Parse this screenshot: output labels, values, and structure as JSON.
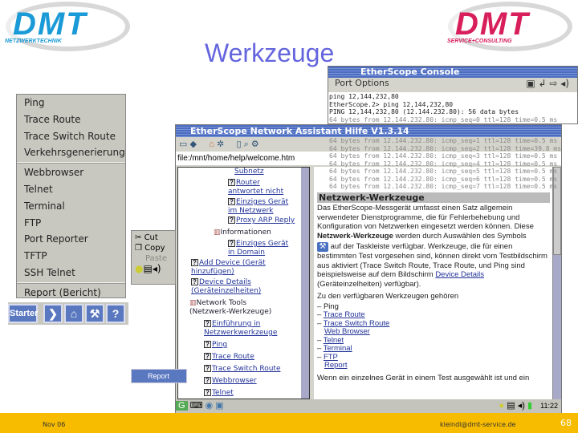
{
  "slide": {
    "title": "Werkzeuge",
    "footer_date": "Nov 06",
    "footer_email": "kleindl@dmt-service.de",
    "page_number": "68"
  },
  "logos": {
    "left": {
      "text": "DMT",
      "tagline": "NETZWERKTECHNIK",
      "color": "#1a9ad6"
    },
    "right": {
      "text": "DMT",
      "tagline": "SERVICE+CONSULTING",
      "color": "#d81e5b"
    }
  },
  "console": {
    "title": "EtherScope Console",
    "menu": "Port Options",
    "lines": [
      "ping 12,144,232,80",
      "EtherScope.2> ping 12,144,232,80",
      "PING 12,144,232,80 (12.144.232.80): 56 data bytes",
      "64 bytes from 12.144.232.80: icmp_seq=0 ttl=128 time=0.5 ms",
      "64 bytes from 12.144.232.80: icmp_seq=1 ttl=128 time=0.5 ms",
      "64 bytes from 12.144.232.80: icmp_seq=2 ttl=128 time=39.8 ms",
      "64 bytes from 12.144.232.80: icmp_seq=3 ttl=128 time=0.5 ms",
      "64 bytes from 12.144.232.80: icmp_seq=4 ttl=128 time=0.5 ms",
      "64 bytes from 12.144.232.80: icmp_seq=5 ttl=128 time=0.5 ms",
      "64 bytes from 12.144.232.80: icmp_seq=6 ttl=128 time=0.5 ms",
      "64 bytes from 12.144.232.80: icmp_seq=7 ttl=128 time=0.5 ms"
    ]
  },
  "assistant": {
    "title": "EtherScope Network Assistant Hilfe V1.3.14",
    "url": "file:/mnt/home/help/welcome.htm",
    "clock": "11:22",
    "tree": [
      {
        "label": "Subnetz",
        "type": "link"
      },
      {
        "label": "Router antwortet nicht",
        "type": "help"
      },
      {
        "label": "Einziges Gerät im Netzwerk",
        "type": "help"
      },
      {
        "label": "Proxy ARP Reply",
        "type": "help"
      },
      {
        "label": "Informationen",
        "type": "book"
      },
      {
        "label": "Einziges Gerät in Domain",
        "type": "help"
      },
      {
        "label": "Add Device (Gerät hinzufügen)",
        "type": "help"
      },
      {
        "label": "Device Details (Geräteinzelheiten)",
        "type": "help"
      },
      {
        "label": "Network Tools (Netzwerk-Werkzeuge)",
        "type": "book"
      },
      {
        "label": "Einführung in Netzwerkwerkzeuge",
        "type": "help"
      },
      {
        "label": "Ping",
        "type": "help"
      },
      {
        "label": "Trace Route",
        "type": "help"
      },
      {
        "label": "Trace Switch Route",
        "type": "help"
      },
      {
        "label": "Webbrowser",
        "type": "help"
      },
      {
        "label": "Telnet",
        "type": "help"
      }
    ],
    "content": {
      "heading": "Netzwerk-Werkzeuge",
      "p1": "Das EtherScope-Messgerät umfasst einen Satz allgemein verwendeter Dienstprogramme, die für Fehlerbehebung und Konfiguration von Netzwerken eingesetzt werden können. Diese",
      "p1_bold": "Netzwerk-Werkzeuge",
      "p1_end": "werden durch Auswählen des Symbols",
      "p2": "auf der Taskleiste verfügbar. Werkzeuge, die für einen bestimmten Test vorgesehen sind, können direkt vom Testbildschirm aus aktiviert (Trace Switch Route, Trace Route, und Ping sind beispielsweise auf dem Bildschirm",
      "p2_link": "Device Details",
      "p2_end": "(Geräteinzelheiten) verfügbar).",
      "p3": "Zu den verfügbaren Werkzeugen gehören",
      "tools": [
        "Ping",
        "Trace Route",
        "Trace Switch Route",
        "Web Browser",
        "Telnet",
        "Terminal",
        "FTP",
        "Report"
      ],
      "p4": "Wenn ein einzelnes Gerät in einem Test ausgewählt ist und ein"
    }
  },
  "tools_menu": {
    "items": [
      "Ping",
      "Trace Route",
      "Trace Switch Route",
      "Verkehrsgenerierung",
      "Webbrowser",
      "Telnet",
      "Terminal",
      "FTP",
      "Port Reporter",
      "TFTP",
      "SSH Telnet",
      "Report (Bericht)"
    ]
  },
  "context_menu": {
    "items": [
      "Cut",
      "Copy",
      "Paste"
    ]
  },
  "taskbar": {
    "starter": "Starter",
    "help": "?",
    "report": "Report"
  }
}
